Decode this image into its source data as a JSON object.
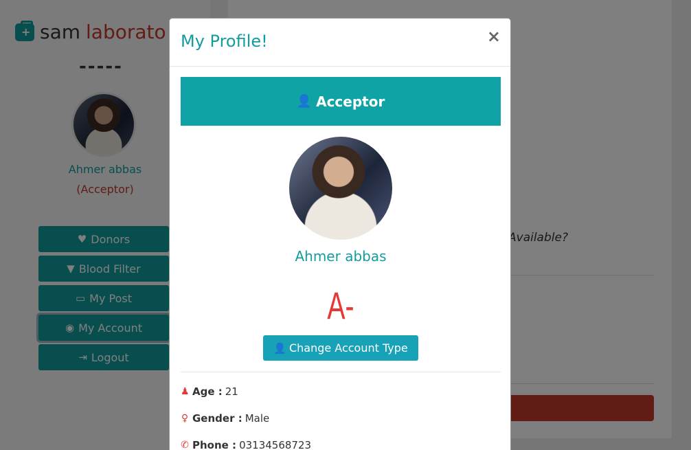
{
  "brand": {
    "icon": "medkit-icon",
    "name_part1": "sam",
    "name_part2": "laborato"
  },
  "sidebar": {
    "divider": "-----",
    "user_name": "Ahmer abbas",
    "user_role": "(Acceptor)",
    "nav": [
      {
        "label": "Donors",
        "icon": "heartbeat-icon"
      },
      {
        "label": "Blood Filter",
        "icon": "filter-icon"
      },
      {
        "label": "My Post",
        "icon": "folder-open-icon"
      },
      {
        "label": "My Account",
        "icon": "user-circle-icon"
      },
      {
        "label": "Logout",
        "icon": "sign-out-icon"
      }
    ]
  },
  "main": {
    "partial_text": "Available?"
  },
  "modal": {
    "title": "My Profile!",
    "close": "×",
    "role_banner": "Acceptor",
    "user_name": "Ahmer abbas",
    "blood_group": "A-",
    "change_button": "Change Account Type",
    "info": {
      "age_label": "Age :",
      "age_value": "21",
      "gender_label": "Gender :",
      "gender_value": "Male",
      "phone_label": "Phone :",
      "phone_value": "03134568723"
    }
  },
  "colors": {
    "accent": "#139c9f",
    "danger": "#e53935",
    "brand_red": "#c0392b"
  }
}
